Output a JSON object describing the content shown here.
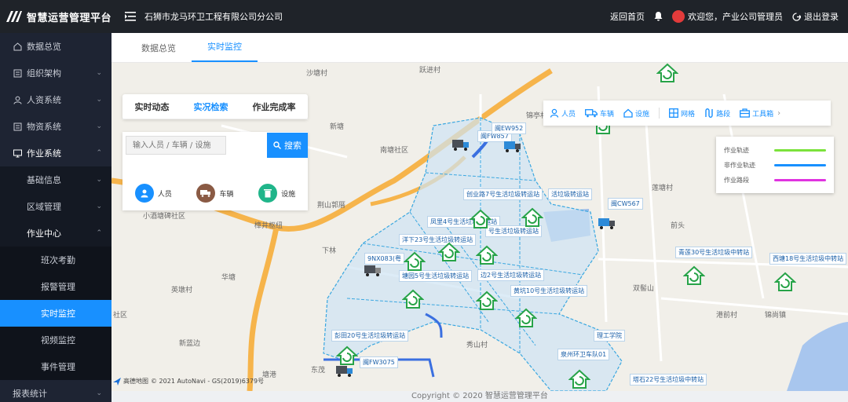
{
  "header": {
    "app_title": "智慧运营管理平台",
    "company": "石狮市龙马环卫工程有限公司分公司",
    "home_link": "返回首页",
    "welcome": "欢迎您，产业公司管理员",
    "logout": "退出登录"
  },
  "sidebar": {
    "items": [
      {
        "label": "数据总览",
        "icon": "monitor-icon"
      },
      {
        "label": "组织架构",
        "icon": "org-icon"
      },
      {
        "label": "人资系统",
        "icon": "user-icon"
      },
      {
        "label": "物资系统",
        "icon": "box-icon"
      },
      {
        "label": "作业系统",
        "icon": "desktop-icon"
      }
    ],
    "work_sub": [
      {
        "label": "基础信息"
      },
      {
        "label": "区域管理"
      },
      {
        "label": "作业中心"
      }
    ],
    "center_sub": [
      {
        "label": "班次考勤"
      },
      {
        "label": "报警管理"
      },
      {
        "label": "实时监控"
      },
      {
        "label": "视频监控"
      },
      {
        "label": "事件管理"
      }
    ],
    "last_item": {
      "label": "报表统计"
    }
  },
  "tabs": [
    {
      "label": "数据总览"
    },
    {
      "label": "实时监控"
    }
  ],
  "panel": {
    "subtabs": [
      "实时动态",
      "实况检索",
      "作业完成率"
    ],
    "search_placeholder": "输入人员 / 车辆 / 设施",
    "search_button": "搜索",
    "categories": [
      {
        "label": "人员",
        "color": "#1890ff"
      },
      {
        "label": "车辆",
        "color": "#8a5a44"
      },
      {
        "label": "设施",
        "color": "#20b58a"
      }
    ]
  },
  "toolbar": {
    "items": [
      "人员",
      "车辆",
      "设施",
      "网格",
      "路段",
      "工具箱"
    ]
  },
  "legend": {
    "rows": [
      {
        "label": "作业轨迹",
        "color": "#7be23b"
      },
      {
        "label": "非作业轨迹",
        "color": "#1890ff"
      },
      {
        "label": "作业路段",
        "color": "#e033e0"
      }
    ]
  },
  "map": {
    "places": [
      "沙塘村",
      "跃进村",
      "新塘",
      "南塘社区",
      "荆山郭厝",
      "小酒塘碑社区",
      "樟井枢纽",
      "下林",
      "华塘",
      "英墩村",
      "新蓝边",
      "东茂",
      "塘港",
      "秀山村",
      "锦亭村",
      "莲塘村",
      "前头",
      "双髻山",
      "港前村",
      "锦尚镇",
      "社区"
    ],
    "stations": [
      "创业路7号生活垃圾转运站",
      "活垃圾转运站",
      "凤里4号生活垃圾转运站",
      "号生活垃圾转运站",
      "洋下23号生活垃圾转运站",
      "塘园5号生活垃圾转运站",
      "边2号生活垃圾转运站",
      "黄坑10号生活垃圾转运站",
      "彭田20号生活垃圾转运站",
      "青莲30号生活垃圾中转站",
      "西塘18号生活垃圾中转站",
      "泉州环卫车队01",
      "塔石22号生活垃圾中转站"
    ],
    "vehicles": [
      "闽CW567",
      "9NX083(粤",
      "闽FW857",
      "闽EW952",
      "闽FW3075",
      "理工学院"
    ],
    "attribution": "高德地图",
    "copyright_map": "© 2021 AutoNavi - GS(2019)6379号"
  },
  "footer": {
    "copyright": "Copyright",
    "copyright_mark": "©",
    "year_text": "2020 智慧运营管理平台"
  }
}
